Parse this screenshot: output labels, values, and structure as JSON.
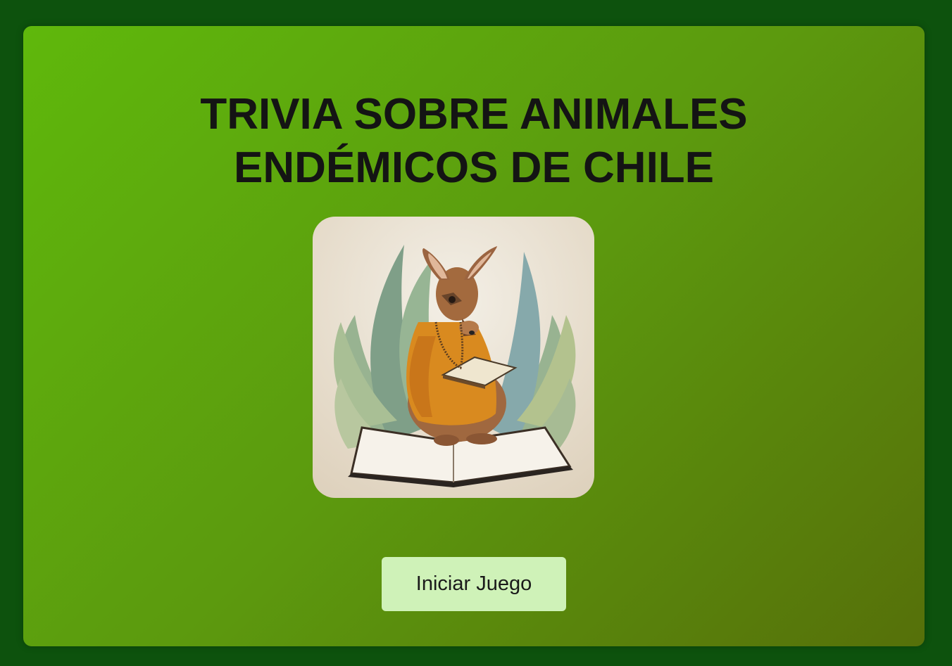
{
  "page": {
    "title_lines": [
      "TRIVIA SOBRE ANIMALES",
      "ENDÉMICOS DE CHILE"
    ]
  },
  "illustration": {
    "icon": "kangaroo-reading-book-illustration"
  },
  "actions": {
    "start_label": "Iniciar Juego"
  },
  "colors": {
    "page_background": "#0d520d",
    "card_gradient_start": "#5fb80c",
    "card_gradient_end": "#56700a",
    "button_background": "#cff2b8"
  }
}
